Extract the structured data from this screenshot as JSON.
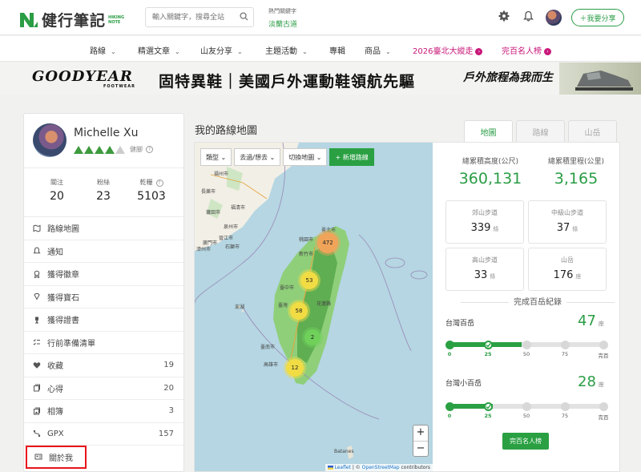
{
  "header": {
    "logo_title": "健行筆記",
    "logo_sub_1": "HIKING",
    "logo_sub_2": "NOTE",
    "search_placeholder": "輸入關鍵字，搜尋全站",
    "hot_label": "熱門關鍵字",
    "hot_value": "淡蘭古道",
    "share_label": "＋我要分享"
  },
  "nav": [
    {
      "label": "路線",
      "caret": "⌄"
    },
    {
      "label": "精選文章",
      "caret": "⌄"
    },
    {
      "label": "山友分享",
      "caret": "⌄"
    },
    {
      "label": "主題活動",
      "caret": "⌄"
    },
    {
      "label": "專輯",
      "caret": ""
    },
    {
      "label": "商品",
      "caret": "⌄"
    },
    {
      "label": "2026臺北大縱走",
      "caret": ""
    },
    {
      "label": "完百名人榜",
      "caret": ""
    }
  ],
  "banner": {
    "brand": "GOODYEAR",
    "brand_sub": "FOOTWEAR",
    "headline": "固特異鞋｜美國戶外運動鞋領航先驅",
    "script": "戶外旅程為我而生"
  },
  "profile": {
    "name": "Michelle Xu",
    "rank_label": "健腳",
    "rank_level": 4,
    "rank_total": 5,
    "stats": [
      {
        "label": "關注",
        "value": "20"
      },
      {
        "label": "粉絲",
        "value": "23"
      },
      {
        "label": "乾糧",
        "value": "5103"
      }
    ],
    "menu": [
      {
        "label": "路線地圖",
        "count": ""
      },
      {
        "label": "通知",
        "count": ""
      },
      {
        "label": "獲得徽章",
        "count": ""
      },
      {
        "label": "獲得寶石",
        "count": ""
      },
      {
        "label": "獲得證書",
        "count": ""
      },
      {
        "label": "行前準備清單",
        "count": ""
      },
      {
        "label": "收藏",
        "count": "19"
      },
      {
        "label": "心得",
        "count": "20"
      },
      {
        "label": "相簿",
        "count": "3"
      },
      {
        "label": "GPX",
        "count": "157"
      },
      {
        "label": "關於我",
        "count": ""
      }
    ]
  },
  "map_section": {
    "title": "我的路線地圖",
    "tabs": [
      "地圖",
      "路線",
      "山岳"
    ],
    "toolbar": [
      "類型 ⌄",
      "去過/想去 ⌄",
      "切換地圖 ⌄",
      "+ 新增路線"
    ],
    "zoom_in": "+",
    "zoom_out": "−",
    "attribution_leaflet": "Leaflet",
    "attribution_osm": "OpenStreetMap",
    "attribution_rest": "contributors",
    "clusters": [
      "472",
      "53",
      "58",
      "2",
      "12"
    ],
    "places": [
      "福州市",
      "莆田市",
      "泉州市",
      "廈門市",
      "漳州市",
      "臺北市",
      "桃園市",
      "新竹市",
      "臺中市",
      "花蓮縣",
      "臺灣",
      "臺南市",
      "高雄市",
      "長樂市",
      "福清市",
      "晉江市",
      "石獅市",
      "澎湖",
      "Batanes"
    ]
  },
  "summary": {
    "elevation_label": "總累積高度(公尺)",
    "elevation_value": "360,131",
    "distance_label": "總累積里程(公里)",
    "distance_value": "3,165",
    "boxes": [
      {
        "label": "郊山步道",
        "value": "339",
        "unit": "條"
      },
      {
        "label": "中級山步道",
        "value": "37",
        "unit": "條"
      },
      {
        "label": "高山步道",
        "value": "33",
        "unit": "條"
      },
      {
        "label": "山岳",
        "value": "176",
        "unit": "座"
      }
    ],
    "completion_title": "完成百岳紀錄",
    "progress": [
      {
        "name": "台灣百岳",
        "count": "47",
        "unit": "座",
        "fraction": 0.47,
        "ticks": [
          "0",
          "25",
          "50",
          "75",
          "完百"
        ]
      },
      {
        "name": "台灣小百岳",
        "count": "28",
        "unit": "座",
        "fraction": 0.28,
        "ticks": [
          "0",
          "25",
          "50",
          "75",
          "完百"
        ]
      }
    ],
    "rank_button": "完百名人榜"
  }
}
